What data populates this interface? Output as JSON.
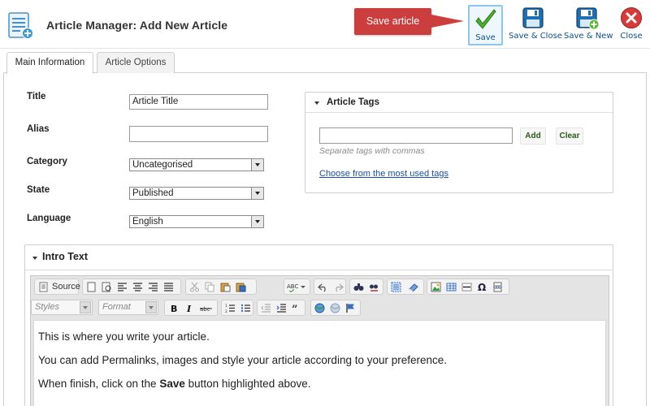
{
  "header": {
    "title": "Article Manager: Add New Article",
    "callout_text": "Save article",
    "buttons": {
      "save": "Save",
      "save_close": "Save & Close",
      "save_new": "Save & New",
      "close": "Close"
    },
    "colors": {
      "callout": "#cc3d3d",
      "toolbar_label": "#0b4f8a"
    }
  },
  "tabs": [
    {
      "label": "Main Information",
      "active": true
    },
    {
      "label": "Article Options",
      "active": false
    }
  ],
  "form": {
    "title": {
      "label": "Title",
      "value": "Article Title"
    },
    "alias": {
      "label": "Alias",
      "value": ""
    },
    "category": {
      "label": "Category",
      "value": "Uncategorised"
    },
    "state": {
      "label": "State",
      "value": "Published"
    },
    "language": {
      "label": "Language",
      "value": "English"
    }
  },
  "tags_panel": {
    "title": "Article Tags",
    "add_label": "Add",
    "clear_label": "Clear",
    "hint": "Separate tags with commas",
    "link": "Choose from the most used tags"
  },
  "intro": {
    "title": "Intro Text",
    "toolbar": {
      "source_label": "Source",
      "styles_placeholder": "Styles",
      "format_placeholder": "Format"
    },
    "body": {
      "line1": "This is where you write your article.",
      "line2": "You can add Permalinks, images and style your article according to your preference.",
      "line3_before": "When finish, click on the ",
      "line3_bold": "Save",
      "line3_after": " button highlighted above."
    }
  }
}
